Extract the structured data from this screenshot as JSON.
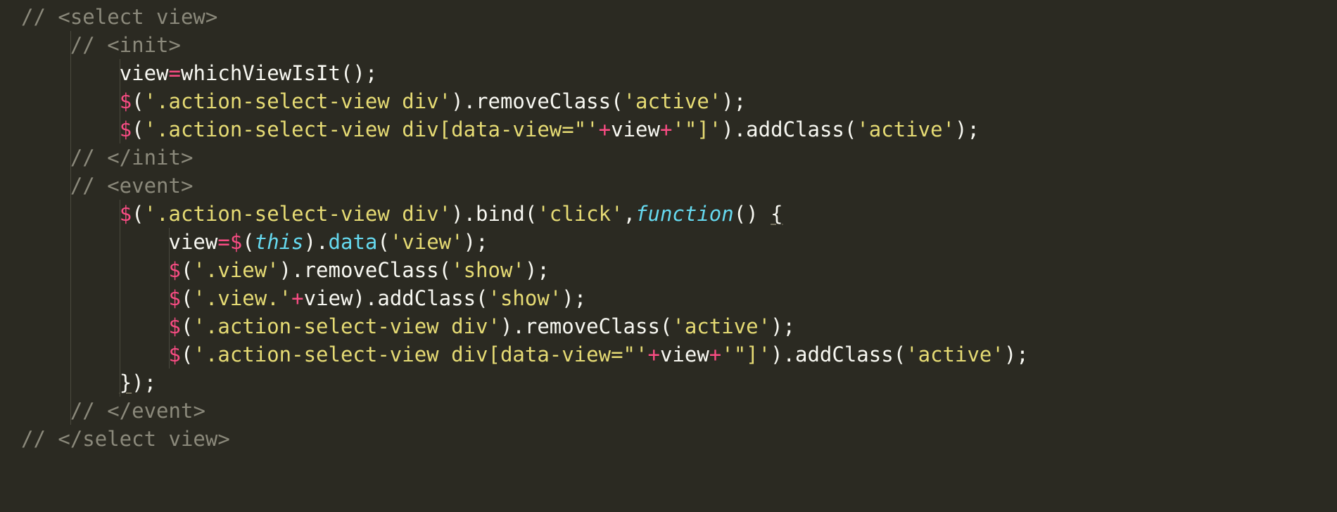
{
  "language": "javascript",
  "theme": "monokai",
  "lines": [
    {
      "indent": 0,
      "guides": [],
      "tokens": [
        {
          "cls": "c-comment",
          "text": "// <select view>"
        }
      ]
    },
    {
      "indent": 1,
      "guides": [
        1
      ],
      "tokens": [
        {
          "cls": "c-comment",
          "text": "// <init>"
        }
      ]
    },
    {
      "indent": 2,
      "guides": [
        1,
        2
      ],
      "tokens": [
        {
          "cls": "c-default",
          "text": "view"
        },
        {
          "cls": "c-op",
          "text": "="
        },
        {
          "cls": "c-default",
          "text": "whichViewIsIt();"
        }
      ]
    },
    {
      "indent": 2,
      "guides": [
        1,
        2
      ],
      "tokens": [
        {
          "cls": "c-dollar",
          "text": "$"
        },
        {
          "cls": "c-default",
          "text": "("
        },
        {
          "cls": "c-string",
          "text": "'.action-select-view div'"
        },
        {
          "cls": "c-default",
          "text": ").removeClass("
        },
        {
          "cls": "c-string",
          "text": "'active'"
        },
        {
          "cls": "c-default",
          "text": ");"
        }
      ]
    },
    {
      "indent": 2,
      "guides": [
        1,
        2
      ],
      "tokens": [
        {
          "cls": "c-dollar",
          "text": "$"
        },
        {
          "cls": "c-default",
          "text": "("
        },
        {
          "cls": "c-string",
          "text": "'.action-select-view div[data-view=\"'"
        },
        {
          "cls": "c-op",
          "text": "+"
        },
        {
          "cls": "c-default",
          "text": "view"
        },
        {
          "cls": "c-op",
          "text": "+"
        },
        {
          "cls": "c-string",
          "text": "'\"]'"
        },
        {
          "cls": "c-default",
          "text": ").addClass("
        },
        {
          "cls": "c-string",
          "text": "'active'"
        },
        {
          "cls": "c-default",
          "text": ");"
        }
      ]
    },
    {
      "indent": 1,
      "guides": [
        1
      ],
      "tokens": [
        {
          "cls": "c-comment",
          "text": "// </init>"
        }
      ]
    },
    {
      "indent": 1,
      "guides": [
        1
      ],
      "tokens": [
        {
          "cls": "c-comment",
          "text": "// <event>"
        }
      ]
    },
    {
      "indent": 2,
      "guides": [
        1,
        2
      ],
      "tokens": [
        {
          "cls": "c-dollar",
          "text": "$"
        },
        {
          "cls": "c-default",
          "text": "("
        },
        {
          "cls": "c-string",
          "text": "'.action-select-view div'"
        },
        {
          "cls": "c-default",
          "text": ").bind("
        },
        {
          "cls": "c-string",
          "text": "'click'"
        },
        {
          "cls": "c-default",
          "text": ","
        },
        {
          "cls": "c-func",
          "text": "function"
        },
        {
          "cls": "c-default",
          "text": "() "
        },
        {
          "cls": "c-default underline",
          "text": "{"
        }
      ]
    },
    {
      "indent": 3,
      "guides": [
        1,
        2,
        3
      ],
      "tokens": [
        {
          "cls": "c-default",
          "text": "view"
        },
        {
          "cls": "c-op",
          "text": "="
        },
        {
          "cls": "c-dollar",
          "text": "$"
        },
        {
          "cls": "c-default",
          "text": "("
        },
        {
          "cls": "c-kw",
          "text": "this"
        },
        {
          "cls": "c-default",
          "text": ")."
        },
        {
          "cls": "c-method",
          "text": "data"
        },
        {
          "cls": "c-default",
          "text": "("
        },
        {
          "cls": "c-string",
          "text": "'view'"
        },
        {
          "cls": "c-default",
          "text": ");"
        }
      ]
    },
    {
      "indent": 3,
      "guides": [
        1,
        2,
        3
      ],
      "tokens": [
        {
          "cls": "c-dollar",
          "text": "$"
        },
        {
          "cls": "c-default",
          "text": "("
        },
        {
          "cls": "c-string",
          "text": "'.view'"
        },
        {
          "cls": "c-default",
          "text": ").removeClass("
        },
        {
          "cls": "c-string",
          "text": "'show'"
        },
        {
          "cls": "c-default",
          "text": ");"
        }
      ]
    },
    {
      "indent": 3,
      "guides": [
        1,
        2,
        3
      ],
      "tokens": [
        {
          "cls": "c-dollar",
          "text": "$"
        },
        {
          "cls": "c-default",
          "text": "("
        },
        {
          "cls": "c-string",
          "text": "'.view.'"
        },
        {
          "cls": "c-op",
          "text": "+"
        },
        {
          "cls": "c-default",
          "text": "view).addClass("
        },
        {
          "cls": "c-string",
          "text": "'show'"
        },
        {
          "cls": "c-default",
          "text": ");"
        }
      ]
    },
    {
      "indent": 3,
      "guides": [
        1,
        2,
        3
      ],
      "tokens": [
        {
          "cls": "c-dollar",
          "text": "$"
        },
        {
          "cls": "c-default",
          "text": "("
        },
        {
          "cls": "c-string",
          "text": "'.action-select-view div'"
        },
        {
          "cls": "c-default",
          "text": ").removeClass("
        },
        {
          "cls": "c-string",
          "text": "'active'"
        },
        {
          "cls": "c-default",
          "text": ");"
        }
      ]
    },
    {
      "indent": 3,
      "guides": [
        1,
        2,
        3
      ],
      "tokens": [
        {
          "cls": "c-dollar",
          "text": "$"
        },
        {
          "cls": "c-default",
          "text": "("
        },
        {
          "cls": "c-string",
          "text": "'.action-select-view div[data-view=\"'"
        },
        {
          "cls": "c-op",
          "text": "+"
        },
        {
          "cls": "c-default",
          "text": "view"
        },
        {
          "cls": "c-op",
          "text": "+"
        },
        {
          "cls": "c-string",
          "text": "'\"]'"
        },
        {
          "cls": "c-default",
          "text": ").addClass("
        },
        {
          "cls": "c-string",
          "text": "'active'"
        },
        {
          "cls": "c-default",
          "text": ");"
        }
      ]
    },
    {
      "indent": 2,
      "guides": [
        1,
        2
      ],
      "tokens": [
        {
          "cls": "c-default underline",
          "text": "}"
        },
        {
          "cls": "c-default",
          "text": ");"
        }
      ]
    },
    {
      "indent": 1,
      "guides": [
        1
      ],
      "tokens": [
        {
          "cls": "c-comment",
          "text": "// </event>"
        }
      ]
    },
    {
      "indent": 0,
      "guides": [],
      "tokens": [
        {
          "cls": "c-comment",
          "text": "// </select view>"
        }
      ]
    }
  ]
}
